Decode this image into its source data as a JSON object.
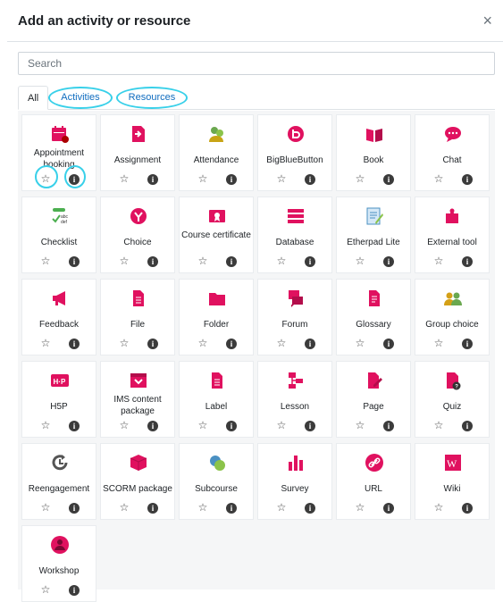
{
  "dialog": {
    "title": "Add an activity or resource",
    "close_symbol": "×"
  },
  "search": {
    "placeholder": "Search"
  },
  "tabs": [
    {
      "label": "All"
    },
    {
      "label": "Activities"
    },
    {
      "label": "Resources"
    }
  ],
  "colors": {
    "accent": "#0f6cbf",
    "icon": "#e0115f",
    "highlight_ring": "#38d0e9"
  },
  "items": [
    {
      "label": "Appointment booking",
      "icon": "calendar-icon"
    },
    {
      "label": "Assignment",
      "icon": "assignment-icon"
    },
    {
      "label": "Attendance",
      "icon": "attendance-icon"
    },
    {
      "label": "BigBlueButton",
      "icon": "bigbluebutton-icon"
    },
    {
      "label": "Book",
      "icon": "book-icon"
    },
    {
      "label": "Chat",
      "icon": "chat-icon"
    },
    {
      "label": "Checklist",
      "icon": "checklist-icon"
    },
    {
      "label": "Choice",
      "icon": "choice-icon"
    },
    {
      "label": "Course certificate",
      "icon": "certificate-icon"
    },
    {
      "label": "Database",
      "icon": "database-icon"
    },
    {
      "label": "Etherpad Lite",
      "icon": "etherpad-icon"
    },
    {
      "label": "External tool",
      "icon": "puzzle-icon"
    },
    {
      "label": "Feedback",
      "icon": "megaphone-icon"
    },
    {
      "label": "File",
      "icon": "file-icon"
    },
    {
      "label": "Folder",
      "icon": "folder-icon"
    },
    {
      "label": "Forum",
      "icon": "forum-icon"
    },
    {
      "label": "Glossary",
      "icon": "glossary-icon"
    },
    {
      "label": "Group choice",
      "icon": "group-choice-icon"
    },
    {
      "label": "H5P",
      "icon": "h5p-icon"
    },
    {
      "label": "IMS content package",
      "icon": "ims-package-icon"
    },
    {
      "label": "Label",
      "icon": "label-icon"
    },
    {
      "label": "Lesson",
      "icon": "lesson-icon"
    },
    {
      "label": "Page",
      "icon": "page-icon"
    },
    {
      "label": "Quiz",
      "icon": "quiz-icon"
    },
    {
      "label": "Reengagement",
      "icon": "reengagement-icon"
    },
    {
      "label": "SCORM package",
      "icon": "scorm-icon"
    },
    {
      "label": "Subcourse",
      "icon": "subcourse-icon"
    },
    {
      "label": "Survey",
      "icon": "survey-icon"
    },
    {
      "label": "URL",
      "icon": "link-icon"
    },
    {
      "label": "Wiki",
      "icon": "wiki-icon"
    },
    {
      "label": "Workshop",
      "icon": "workshop-icon"
    }
  ],
  "glyphs": {
    "star": "☆",
    "info": "i"
  }
}
